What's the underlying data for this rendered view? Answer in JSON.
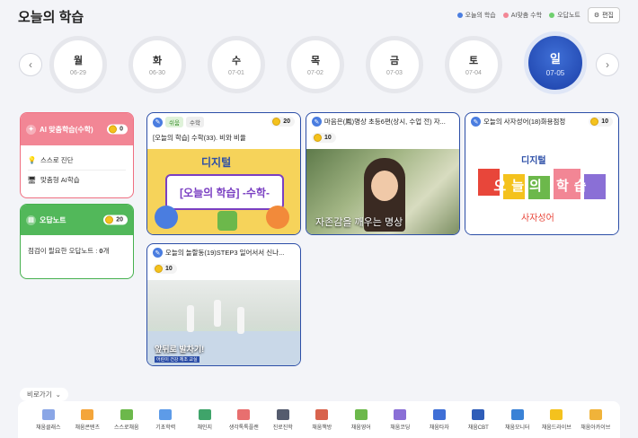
{
  "header": {
    "title": "오늘의 학습",
    "legend": [
      {
        "label": "오늘의 학습",
        "color": "#4a7de0"
      },
      {
        "label": "AI맞춤 수학",
        "color": "#f28695"
      },
      {
        "label": "오답노트",
        "color": "#6fcf6f"
      }
    ],
    "settings_label": "편집"
  },
  "days": [
    {
      "name": "월",
      "date": "06-29"
    },
    {
      "name": "화",
      "date": "06-30"
    },
    {
      "name": "수",
      "date": "07-01"
    },
    {
      "name": "목",
      "date": "07-02"
    },
    {
      "name": "금",
      "date": "07-03"
    },
    {
      "name": "토",
      "date": "07-04"
    },
    {
      "name": "일",
      "date": "07-05",
      "active": true
    }
  ],
  "ai_card": {
    "title": "AI 맞춤학습(수학)",
    "coins": "0",
    "items": [
      "스스로 진단",
      "맞춤형 AI학습"
    ]
  },
  "wrong_card": {
    "title": "오답노트",
    "coins": "20",
    "text_prefix": "점검이 필요한 오답노트 : ",
    "count": "0",
    "text_suffix": "개"
  },
  "videos": [
    {
      "tag1": "쉬움",
      "tag2": "수학",
      "title": "[오늘의 학습] 수학(33). 비와 비율",
      "coins": "20",
      "thumb_text": "[오늘의 학습] -수학-",
      "brand": "디지털"
    },
    {
      "title": "마음은(鳳)명상 초등6편(상시, 수업 전) 자...",
      "coins": "10",
      "thumb_text": "자존감을 깨우는 명상"
    },
    {
      "title": "오늘의 사자성어(18)화용점정",
      "coins": "10",
      "thumb_text": "오늘의 학습",
      "sub_text": "사자성어",
      "brand": "디지털"
    },
    {
      "title": "오늘의 놀할동(19)STEP3 일어서서 신나...",
      "coins": "10",
      "thumb_text": "앞뒤로 발차기!",
      "sub_text": "어린이 건강 체조 교실"
    }
  ],
  "bottom": {
    "fold_label": "비로가기",
    "apps": [
      {
        "label": "채움클래스",
        "color": "#8aa6e6"
      },
      {
        "label": "채움콘텐츠",
        "color": "#f4a53a"
      },
      {
        "label": "스스로채움",
        "color": "#6cb84b"
      },
      {
        "label": "기초학력",
        "color": "#5d9be8"
      },
      {
        "label": "채인지",
        "color": "#3fa46a"
      },
      {
        "label": "생각톡톡플랜",
        "color": "#e86f6f"
      },
      {
        "label": "진로진학",
        "color": "#555c6e"
      },
      {
        "label": "채움책방",
        "color": "#d8634d"
      },
      {
        "label": "채움영어",
        "color": "#6cb84b"
      },
      {
        "label": "채움코딩",
        "color": "#8a6fd6"
      },
      {
        "label": "채움타자",
        "color": "#3f6fd6"
      },
      {
        "label": "채움CBT",
        "color": "#2f5db8"
      },
      {
        "label": "채움모니터",
        "color": "#3a82d6"
      },
      {
        "label": "채움드라이브",
        "color": "#f4c21d"
      },
      {
        "label": "채움아카이브",
        "color": "#f0b33a"
      }
    ]
  }
}
